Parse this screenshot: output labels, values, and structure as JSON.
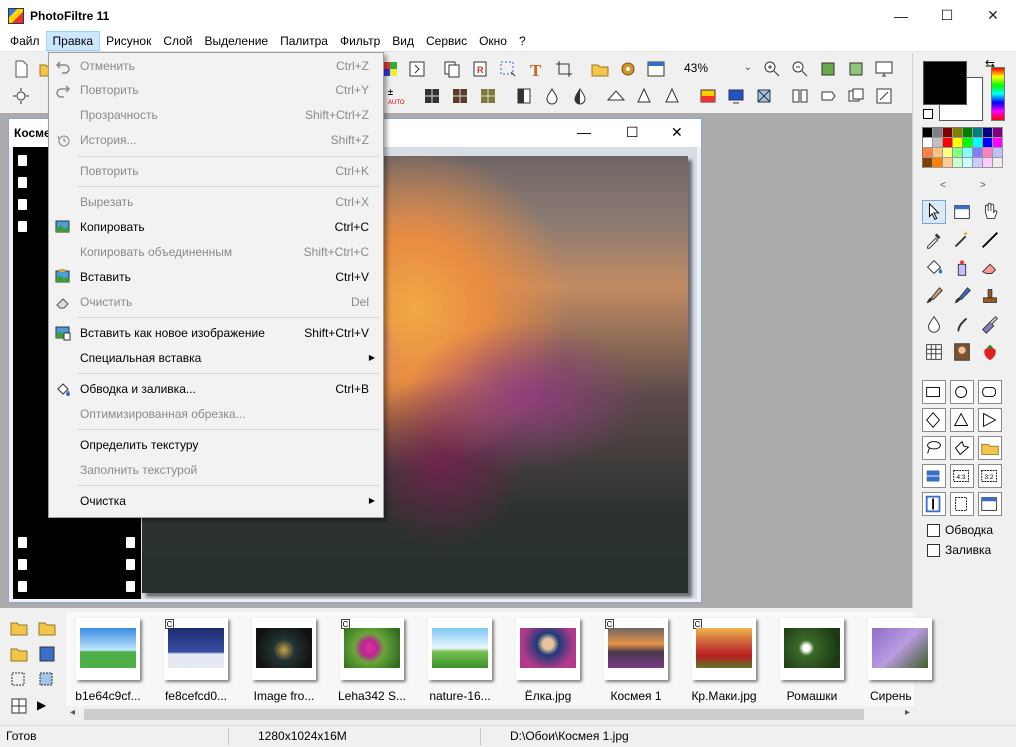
{
  "app": {
    "title": "PhotoFiltre 11"
  },
  "window_controls": {
    "minimize": "—",
    "maximize": "☐",
    "close": "✕"
  },
  "menu": [
    {
      "label": "Файл"
    },
    {
      "label": "Правка"
    },
    {
      "label": "Рисунок"
    },
    {
      "label": "Слой"
    },
    {
      "label": "Выделение"
    },
    {
      "label": "Палитра"
    },
    {
      "label": "Фильтр"
    },
    {
      "label": "Вид"
    },
    {
      "label": "Сервис"
    },
    {
      "label": "Окно"
    },
    {
      "label": "?"
    }
  ],
  "toolbar": {
    "zoom_value": "43%"
  },
  "document": {
    "tab_label": "Косме"
  },
  "edit_menu": {
    "items": [
      {
        "label": "Отменить",
        "shortcut": "Ctrl+Z"
      },
      {
        "label": "Повторить",
        "shortcut": "Ctrl+Y"
      },
      {
        "label": "Прозрачность",
        "shortcut": "Shift+Ctrl+Z"
      },
      {
        "label": "История...",
        "shortcut": "Shift+Z"
      },
      {
        "label": "Повторить",
        "shortcut": "Ctrl+K"
      },
      {
        "label": "Вырезать",
        "shortcut": "Ctrl+X"
      },
      {
        "label": "Копировать",
        "shortcut": "Ctrl+C"
      },
      {
        "label": "Копировать объединенным",
        "shortcut": "Shift+Ctrl+C"
      },
      {
        "label": "Вставить",
        "shortcut": "Ctrl+V"
      },
      {
        "label": "Очистить",
        "shortcut": "Del"
      },
      {
        "label": "Вставить как новое изображение",
        "shortcut": "Shift+Ctrl+V"
      },
      {
        "label": "Специальная вставка",
        "shortcut": ""
      },
      {
        "label": "Обводка и заливка...",
        "shortcut": "Ctrl+B"
      },
      {
        "label": "Оптимизированная обрезка...",
        "shortcut": ""
      },
      {
        "label": "Определить текстуру",
        "shortcut": ""
      },
      {
        "label": "Заполнить текстурой",
        "shortcut": ""
      },
      {
        "label": "Очистка",
        "shortcut": ""
      }
    ]
  },
  "right_panel": {
    "outline_label": "Обводка",
    "fill_label": "Заливка",
    "colors": {
      "foreground": "#000000",
      "background": "#ffffff"
    }
  },
  "thumbnails": [
    {
      "label": "b1e64c9cf...",
      "badge": ""
    },
    {
      "label": "fe8cefcd0...",
      "badge": "C"
    },
    {
      "label": "Image fro...",
      "badge": ""
    },
    {
      "label": "Leha342 S...",
      "badge": "C"
    },
    {
      "label": "nature-16...",
      "badge": ""
    },
    {
      "label": "Ёлка.jpg",
      "badge": ""
    },
    {
      "label": "Космея 1",
      "badge": "C"
    },
    {
      "label": "Кр.Маки.jpg",
      "badge": "C"
    },
    {
      "label": "Ромашки",
      "badge": ""
    },
    {
      "label": "Сирень",
      "badge": ""
    }
  ],
  "status": {
    "state": "Готов",
    "dimensions": "1280x1024x16M",
    "path": "D:\\Обои\\Космея 1.jpg"
  }
}
